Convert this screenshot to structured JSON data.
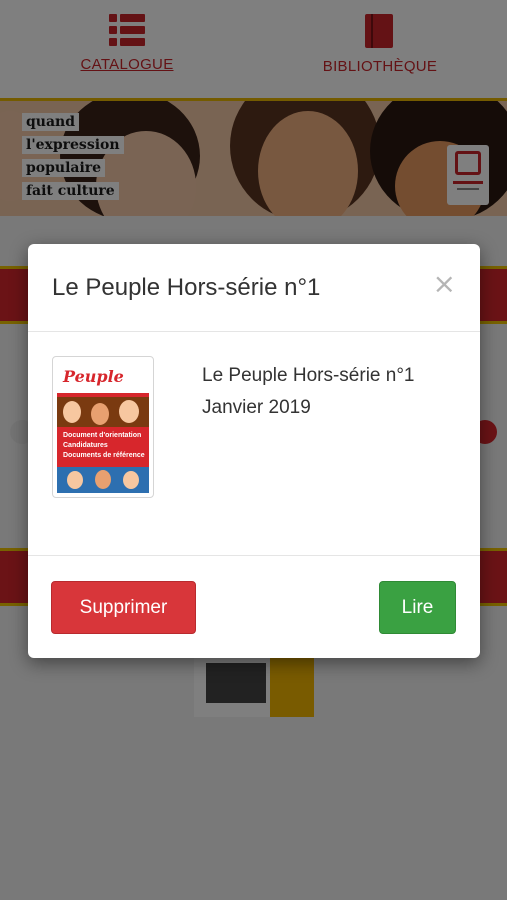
{
  "nav": {
    "catalogue_label": "CATALOGUE",
    "bibliotheque_label": "BIBLIOTHÈQUE"
  },
  "banner": {
    "lines": [
      "quand",
      "l'expression",
      "populaire",
      "fait culture"
    ]
  },
  "modal": {
    "title": "Le Peuple Hors-série n°1",
    "close_symbol": "×",
    "publication": {
      "name": "Le Peuple Hors-série n°1",
      "date": "Janvier 2019"
    },
    "cover": {
      "logo": "Peuple",
      "lines": [
        "Document d'orientation",
        "Candidatures",
        "Documents de référence"
      ]
    },
    "delete_label": "Supprimer",
    "read_label": "Lire"
  },
  "colors": {
    "brand_red": "#c9252b",
    "delete_red": "#d8363a",
    "read_green": "#3aa142"
  },
  "icons": {
    "catalogue": "list-icon",
    "library": "book-icon",
    "close": "close-icon"
  }
}
